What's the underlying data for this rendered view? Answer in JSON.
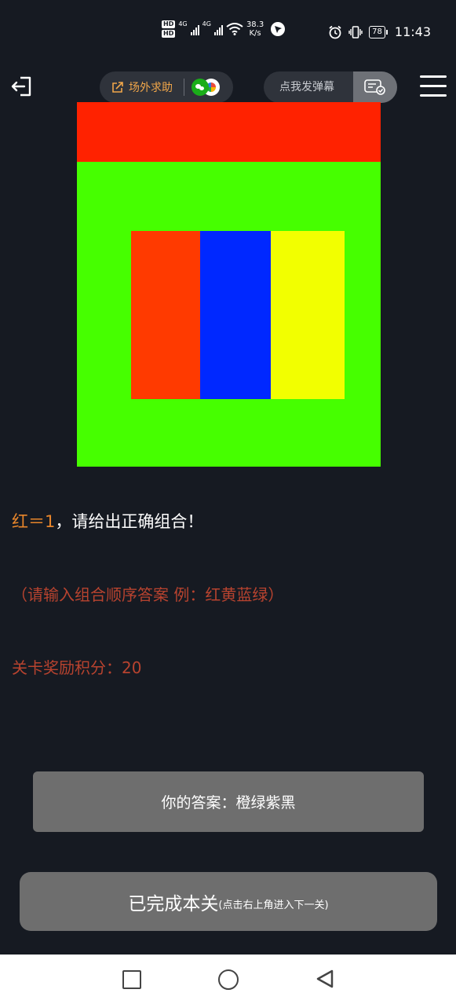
{
  "status_bar": {
    "hd1": "HD",
    "hd2": "HD",
    "net1": "4G",
    "net2": "4G",
    "speed_value": "38.3",
    "speed_unit": "K/s",
    "battery": "78",
    "time": "11:43"
  },
  "top_bar": {
    "help_label": "场外求助",
    "danmaku_placeholder": "点我发弹幕"
  },
  "puzzle": {
    "colors": {
      "background": "#46ff00",
      "top_band": "#ff2200",
      "block_red": "#ff3a00",
      "block_blue": "#0028ff",
      "block_yellow": "#f2ff00"
    }
  },
  "hint": {
    "key": "红＝1",
    "rest": "，请给出正确组合！"
  },
  "instruction": "（请输入组合顺序答案 例：红黄蓝绿）",
  "reward": "关卡奖励积分：20",
  "answer": "你的答案：橙绿紫黑",
  "complete": {
    "main": "已完成本关",
    "sub": "(点击右上角进入下一关)"
  }
}
